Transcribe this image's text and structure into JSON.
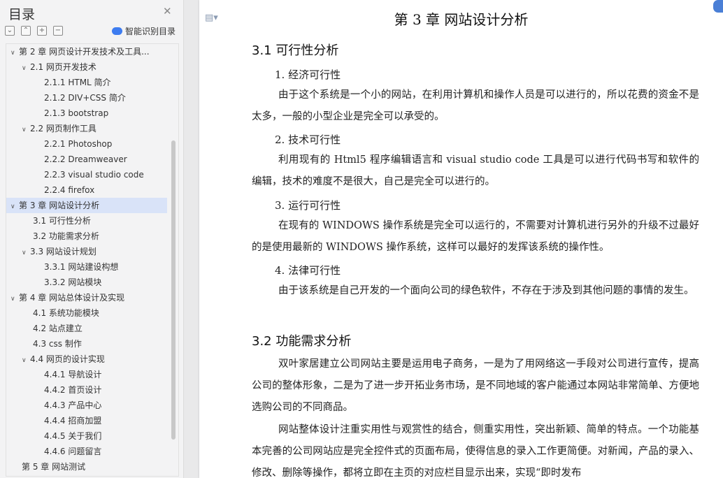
{
  "sidebar": {
    "title": "目录",
    "smart_label": "智能识别目录",
    "toc": [
      {
        "label": "第 2 章  网页设计开发技术及工具...",
        "level": 1,
        "arrow": true
      },
      {
        "label": "2.1  网页开发技术",
        "level": 2,
        "arrow": true
      },
      {
        "label": "2.1.1 HTML 简介",
        "level": 3
      },
      {
        "label": "2.1.2 DIV+CSS 简介",
        "level": 3
      },
      {
        "label": "2.1.3 bootstrap",
        "level": 3
      },
      {
        "label": "2.2  网页制作工具",
        "level": 2,
        "arrow": true
      },
      {
        "label": "2.2.1 Photoshop",
        "level": 3
      },
      {
        "label": "2.2.2 Dreamweaver",
        "level": 3
      },
      {
        "label": "2.2.3 visual studio code",
        "level": 3
      },
      {
        "label": "2.2.4 firefox",
        "level": 3
      },
      {
        "label": "第 3 章  网站设计分析",
        "level": 1,
        "arrow": true,
        "selected": true
      },
      {
        "label": "3.1  可行性分析",
        "level": 2
      },
      {
        "label": "3.2  功能需求分析",
        "level": 2
      },
      {
        "label": "3.3  网站设计规划",
        "level": 2,
        "arrow": true
      },
      {
        "label": "3.3.1  网站建设构想",
        "level": 3
      },
      {
        "label": "3.3.2  网站模块",
        "level": 3
      },
      {
        "label": "第 4 章  网站总体设计及实现",
        "level": 1,
        "arrow": true
      },
      {
        "label": "4.1  系统功能模块",
        "level": 2
      },
      {
        "label": "4.2  站点建立",
        "level": 2
      },
      {
        "label": "4.3 css 制作",
        "level": 2
      },
      {
        "label": "4.4  网页的设计实现",
        "level": 2,
        "arrow": true
      },
      {
        "label": "4.4.1  导航设计",
        "level": 3
      },
      {
        "label": "4.4.2  首页设计",
        "level": 3
      },
      {
        "label": "4.4.3  产品中心",
        "level": 3
      },
      {
        "label": "4.4.4  招商加盟",
        "level": 3
      },
      {
        "label": "4.4.5  关于我们",
        "level": 3
      },
      {
        "label": "4.4.6  问题留言",
        "level": 3
      },
      {
        "label": "第 5 章  网站测试",
        "level": 1
      }
    ]
  },
  "document": {
    "chapter_title": "第 3 章  网站设计分析",
    "sec31_title": "3.1  可行性分析",
    "item1": "1.   经济可行性",
    "para1": "由于这个系统是一个小的网站，在利用计算机和操作人员是可以进行的，所以花费的资金不是太多，一般的小型企业是完全可以承受的。",
    "item2": "2.   技术可行性",
    "para2": "利用现有的 Html5  程序编辑语言和 visual studio code 工具是可以进行代码书写和软件的编辑，技术的难度不是很大，自己是完全可以进行的。",
    "item3": "3.   运行可行性",
    "para3": "在现有的 WINDOWS 操作系统是完全可以运行的，不需要对计算机进行另外的升级不过最好的是使用最新的 WINDOWS 操作系统，这样可以最好的发挥该系统的操作性。",
    "item4": "4.   法律可行性",
    "para4": "由于该系统是自己开发的一个面向公司的绿色软件，不存在于涉及到其他问题的事情的发生。",
    "sec32_title": "3.2  功能需求分析",
    "para5": "双叶家居建立公司网站主要是运用电子商务，一是为了用网络这一手段对公司进行宣传，提高公司的整体形象，二是为了进一步开拓业务市场，是不同地域的客户能通过本网站非常简单、方便地选购公司的不同商品。",
    "para6": "网站整体设计注重实用性与观赏性的结合，侧重实用性，突出新颖、简单的特点。一个功能基本完善的公司网站应是完全控件式的页面布局，使得信息的录入工作更简便。对新闻，产品的录入、修改、删除等操作，都将立即在主页的对应栏目显示出来，实现“即时发布"
  },
  "colors": {
    "accent": "#3d7cf0",
    "selected_bg": "#d9e3f8"
  }
}
